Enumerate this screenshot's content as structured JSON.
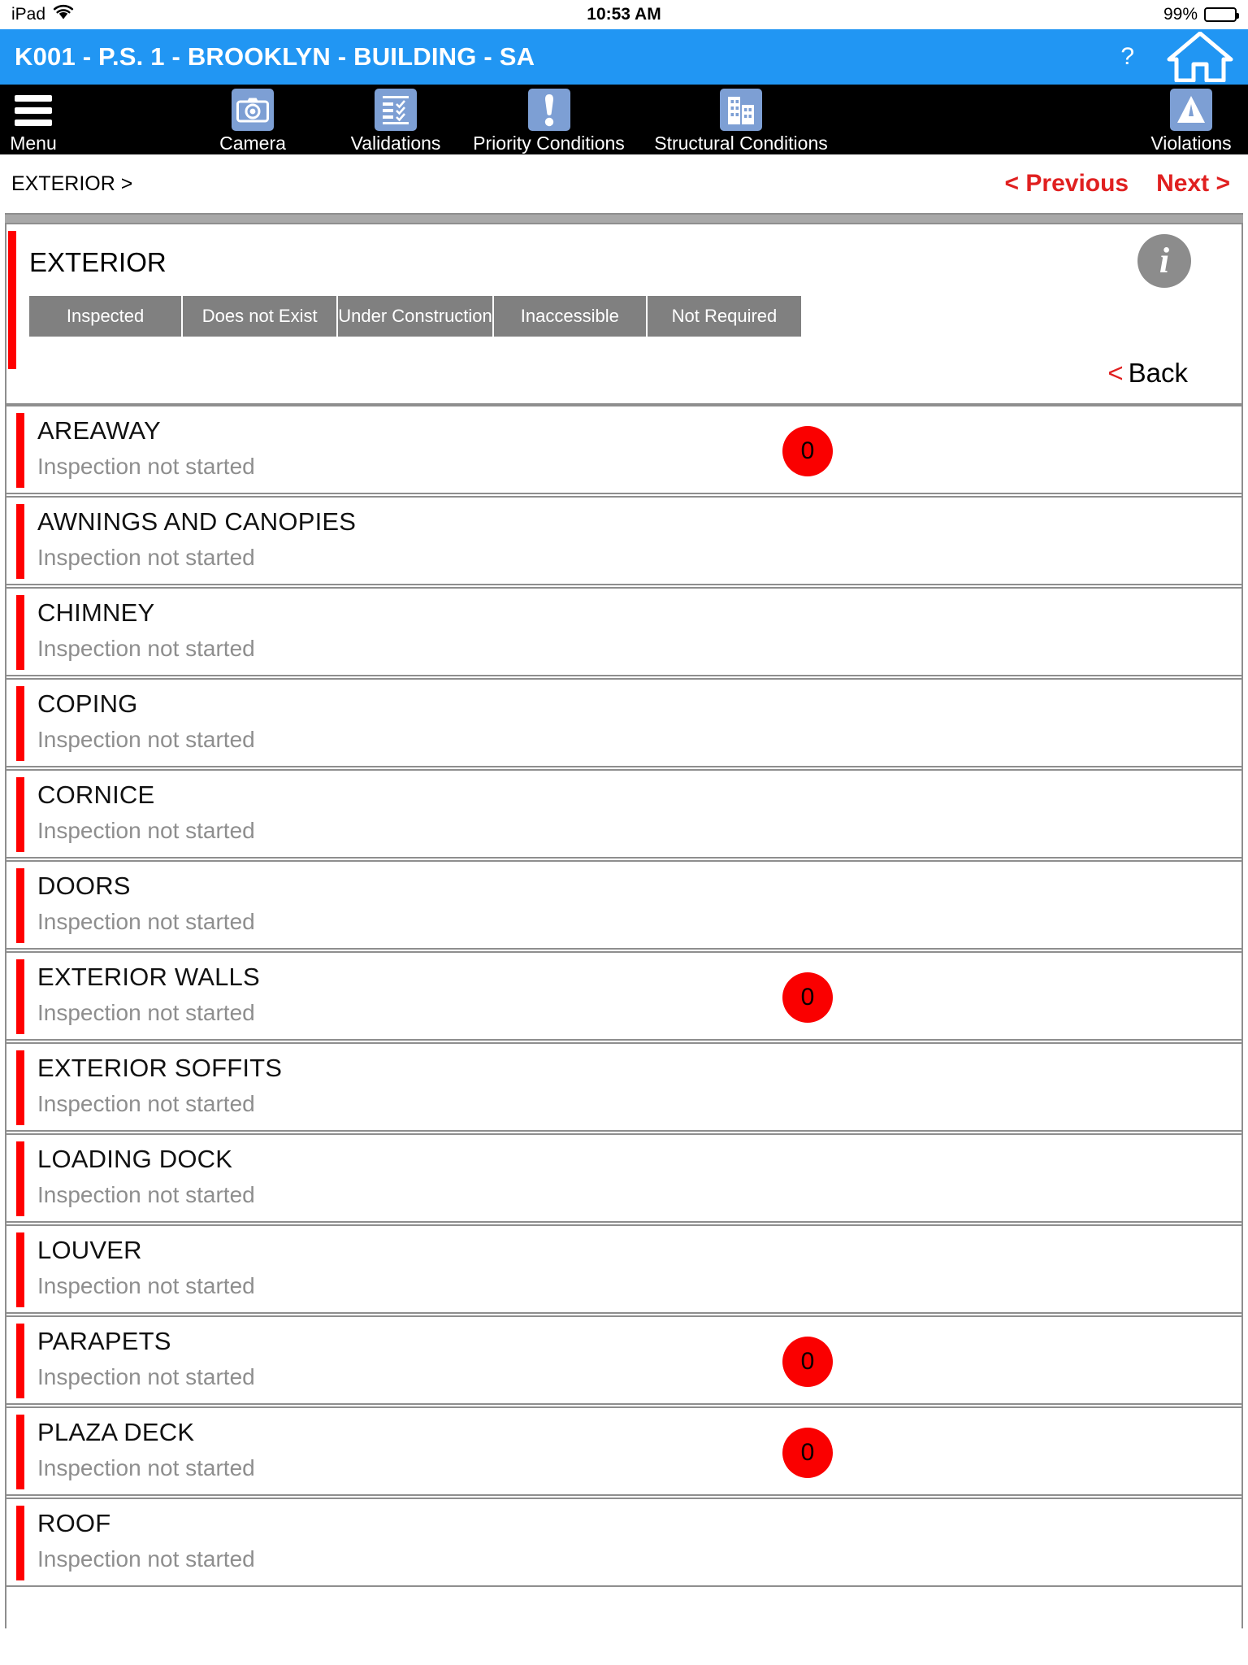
{
  "status_bar": {
    "device": "iPad",
    "wifi_icon": "wifi-icon",
    "time": "10:53 AM",
    "battery_percent": "99%",
    "battery_icon": "battery-icon"
  },
  "title_bar": {
    "title": "K001 - P.S. 1 - BROOKLYN - BUILDING - SA",
    "help_label": "?",
    "home_icon": "home-icon"
  },
  "toolbar": {
    "items": [
      {
        "label": "Menu",
        "icon": "hamburger-menu-icon"
      },
      {
        "label": "Camera",
        "icon": "camera-icon"
      },
      {
        "label": "Validations",
        "icon": "checklist-icon"
      },
      {
        "label": "Priority Conditions",
        "icon": "exclamation-icon"
      },
      {
        "label": "Structural Conditions",
        "icon": "building-icon"
      },
      {
        "label": "Violations",
        "icon": "warning-triangle-icon"
      }
    ]
  },
  "breadcrumb": {
    "path": "EXTERIOR >",
    "previous_label": "< Previous",
    "next_label": "Next >"
  },
  "section": {
    "title": "EXTERIOR",
    "info_label": "i",
    "segments": [
      "Inspected",
      "Does not Exist",
      "Under Construction",
      "Inaccessible",
      "Not Required"
    ],
    "back_chevron": "<",
    "back_label": "Back"
  },
  "list": {
    "status_text": "Inspection not started",
    "rows": [
      {
        "title": "AREAWAY",
        "status": "Inspection not started",
        "badge": "0"
      },
      {
        "title": "AWNINGS AND CANOPIES",
        "status": "Inspection not started",
        "badge": null
      },
      {
        "title": "CHIMNEY",
        "status": "Inspection not started",
        "badge": null
      },
      {
        "title": "COPING",
        "status": "Inspection not started",
        "badge": null
      },
      {
        "title": "CORNICE",
        "status": "Inspection not started",
        "badge": null
      },
      {
        "title": "DOORS",
        "status": "Inspection not started",
        "badge": null
      },
      {
        "title": "EXTERIOR WALLS",
        "status": "Inspection not started",
        "badge": "0"
      },
      {
        "title": "EXTERIOR SOFFITS",
        "status": "Inspection not started",
        "badge": null
      },
      {
        "title": "LOADING DOCK",
        "status": "Inspection not started",
        "badge": null
      },
      {
        "title": "LOUVER",
        "status": "Inspection not started",
        "badge": null
      },
      {
        "title": "PARAPETS",
        "status": "Inspection not started",
        "badge": "0"
      },
      {
        "title": "PLAZA DECK",
        "status": "Inspection not started",
        "badge": "0"
      },
      {
        "title": "ROOF",
        "status": "Inspection not started",
        "badge": null
      }
    ]
  },
  "colors": {
    "title_bar_blue": "#2196f3",
    "toolbar_black": "#000000",
    "accent_red": "#ff0000",
    "link_red": "#e02020",
    "segment_grey": "#808080",
    "muted_grey": "#8e8e8e",
    "icon_tile_blue": "#7d9fd4"
  }
}
